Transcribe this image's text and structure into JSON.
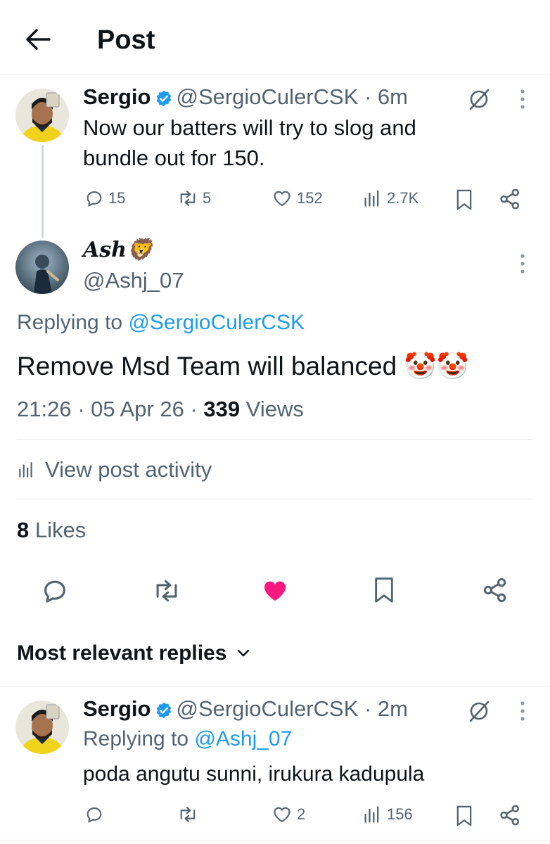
{
  "header": {
    "title": "Post"
  },
  "parent": {
    "name": "Sergio",
    "handle": "@SergioCulerCSK",
    "time": "· 6m",
    "text": "Now our batters will try to slog and bundle out for 150.",
    "stats": {
      "replies": "15",
      "reposts": "5",
      "likes": "152",
      "views": "2.7K"
    }
  },
  "main": {
    "name": "Ash",
    "name_emoji": "🦁",
    "handle": "@Ashj_07",
    "replying_label": "Replying to",
    "replying_handle": "@SergioCulerCSK",
    "text": "Remove Msd Team will balanced",
    "text_emoji": "🤡🤡",
    "timestamp": "21:26 · 05 Apr 26 ·",
    "views_count": "339",
    "views_label": "Views",
    "activity_label": "View post activity",
    "likes_count": "8",
    "likes_label": "Likes",
    "liked": true,
    "like_color": "#f91880"
  },
  "replies_filter": {
    "label": "Most relevant replies"
  },
  "reply": {
    "name": "Sergio",
    "handle": "@SergioCulerCSK",
    "time": "· 2m",
    "replying_label": "Replying to",
    "replying_handle": "@Ashj_07",
    "text": "poda angutu sunni, irukura kadupula",
    "stats": {
      "replies": "",
      "reposts": "",
      "likes": "2",
      "views": "156"
    }
  },
  "colors": {
    "accent": "#1d9bf0",
    "text": "#0f1419",
    "muted": "#536471",
    "divider": "#e6e9eb"
  }
}
